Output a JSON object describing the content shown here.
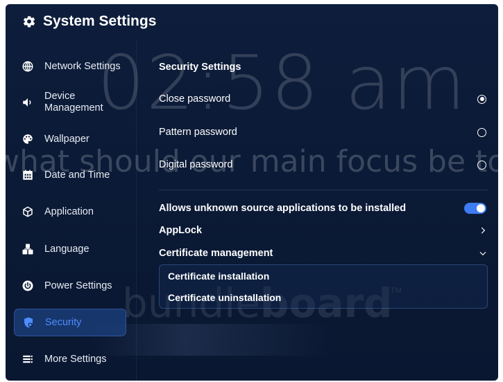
{
  "wallpaper": {
    "clock": "02:58 am",
    "focus_prompt": "what should our main focus be today",
    "brand_light": "bundle",
    "brand_bold": "board",
    "brand_mark": "TM"
  },
  "header": {
    "icon": "gear-icon",
    "title": "System Settings"
  },
  "sidebar": {
    "items": [
      {
        "label": "Network Settings",
        "icon": "globe-icon"
      },
      {
        "label": "Device Management",
        "icon": "speaker-icon"
      },
      {
        "label": "Wallpaper",
        "icon": "palette-icon"
      },
      {
        "label": "Date and Time",
        "icon": "calendar-icon"
      },
      {
        "label": "Application",
        "icon": "cube-icon"
      },
      {
        "label": "Language",
        "icon": "language-icon"
      },
      {
        "label": "Power Settings",
        "icon": "power-icon"
      },
      {
        "label": "Security",
        "icon": "shield-icon",
        "active": true
      },
      {
        "label": "More Settings",
        "icon": "menu-icon"
      }
    ]
  },
  "security": {
    "title": "Security Settings",
    "password_options": [
      {
        "label": "Close password",
        "selected": true
      },
      {
        "label": "Pattern password",
        "selected": false
      },
      {
        "label": "Digital password",
        "selected": false
      }
    ],
    "unknown_sources_label": "Allows unknown source applications to be installed",
    "unknown_sources_enabled": true,
    "applock_label": "AppLock",
    "cert_management_label": "Certificate management",
    "cert_installation_label": "Certificate installation",
    "cert_uninstallation_label": "Certificate uninstallation"
  },
  "colors": {
    "background": "#0b1a36",
    "accent": "#3d7cf2",
    "active_text": "#4d8dff"
  }
}
